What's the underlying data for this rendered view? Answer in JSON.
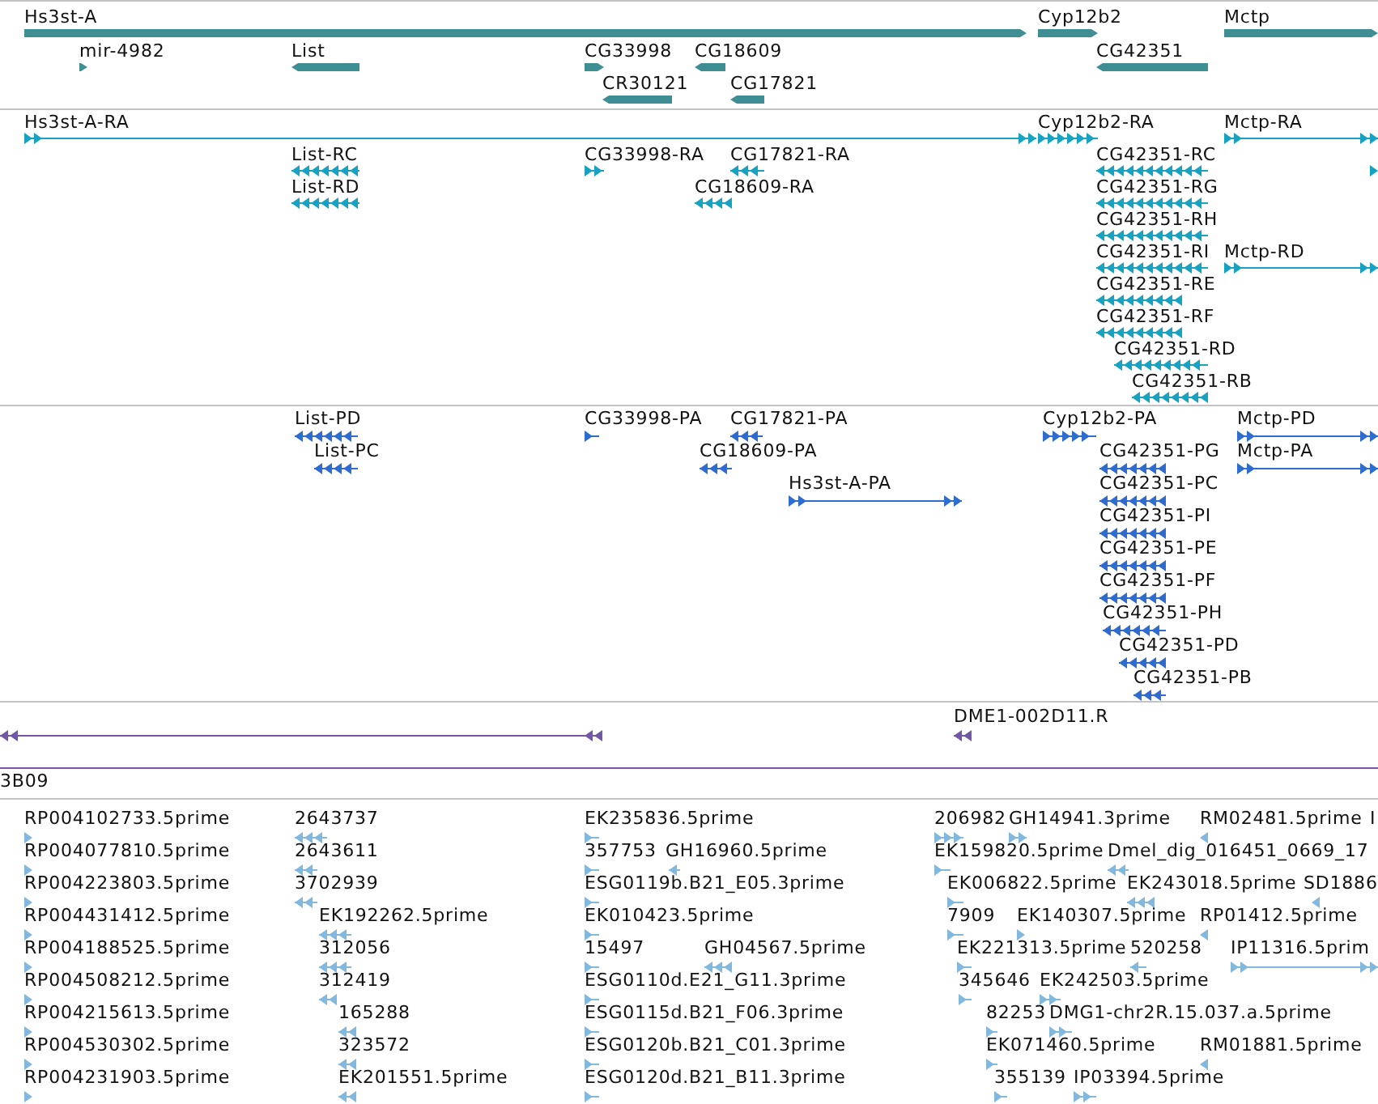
{
  "tracks": [
    {
      "kind": "gene",
      "color": "#3f8e93",
      "features": [
        {
          "label": "Hs3st-A",
          "reverse": false
        },
        {
          "label": "mir-4982",
          "reverse": false
        },
        {
          "label": "List",
          "reverse": true
        },
        {
          "label": "CG33998",
          "reverse": false
        },
        {
          "label": "CR30121",
          "reverse": true
        },
        {
          "label": "CG18609",
          "reverse": true
        },
        {
          "label": "CG17821",
          "reverse": true
        },
        {
          "label": "Cyp12b2",
          "reverse": false
        },
        {
          "label": "CG42351",
          "reverse": true
        },
        {
          "label": "Mctp",
          "reverse": false
        }
      ]
    },
    {
      "kind": "transcript",
      "color": "#17a2c2",
      "features": [
        {
          "label": "Hs3st-A-RA",
          "reverse": false
        },
        {
          "label": "Cyp12b2-RA",
          "reverse": false
        },
        {
          "label": "Mctp-RA",
          "reverse": false
        },
        {
          "label": "List-RC",
          "reverse": true
        },
        {
          "label": "CG33998-RA",
          "reverse": false
        },
        {
          "label": "CG17821-RA",
          "reverse": true
        },
        {
          "label": "CG42351-RC",
          "reverse": true
        },
        {
          "reverse": false
        },
        {
          "label": "List-RD",
          "reverse": true
        },
        {
          "label": "CG18609-RA",
          "reverse": true
        },
        {
          "label": "CG42351-RG",
          "reverse": true
        },
        {
          "label": "CG42351-RH",
          "reverse": true
        },
        {
          "label": "CG42351-RI",
          "reverse": true
        },
        {
          "label": "Mctp-RD",
          "reverse": false
        },
        {
          "label": "CG42351-RE",
          "reverse": true
        },
        {
          "label": "CG42351-RF",
          "reverse": true
        },
        {
          "label": "CG42351-RD",
          "reverse": true
        },
        {
          "label": "CG42351-RB",
          "reverse": true
        }
      ]
    },
    {
      "kind": "protein",
      "color": "#2f6ccf",
      "features": [
        {
          "label": "List-PD",
          "reverse": true
        },
        {
          "label": "CG33998-PA",
          "reverse": false
        },
        {
          "label": "CG17821-PA",
          "reverse": true
        },
        {
          "label": "Cyp12b2-PA",
          "reverse": false
        },
        {
          "label": "Mctp-PD",
          "reverse": false
        },
        {
          "label": "List-PC",
          "reverse": true
        },
        {
          "label": "CG18609-PA",
          "reverse": true
        },
        {
          "label": "CG42351-PG",
          "reverse": true
        },
        {
          "label": "Mctp-PA",
          "reverse": false
        },
        {
          "label": "Hs3st-A-PA",
          "reverse": false
        },
        {
          "label": "CG42351-PC",
          "reverse": true
        },
        {
          "label": "CG42351-PI",
          "reverse": true
        },
        {
          "label": "CG42351-PE",
          "reverse": true
        },
        {
          "label": "CG42351-PF",
          "reverse": true
        },
        {
          "label": "CG42351-PH",
          "reverse": true
        },
        {
          "label": "CG42351-PD",
          "reverse": true
        },
        {
          "label": "CG42351-PB",
          "reverse": true
        }
      ]
    },
    {
      "kind": "clone",
      "color": "#7157a6",
      "features": [
        {
          "reverse": true
        },
        {
          "label": "DME1-002D11.R",
          "reverse": true
        },
        {
          "kind": "span"
        },
        {
          "label": "3B09"
        }
      ]
    },
    {
      "kind": "est",
      "color": "#82b7de",
      "features": [
        {
          "label": "RP004102733.5prime",
          "reverse": false
        },
        {
          "label": "RP004077810.5prime",
          "reverse": false
        },
        {
          "label": "RP004223803.5prime",
          "reverse": false
        },
        {
          "label": "RP004431412.5prime",
          "reverse": false
        },
        {
          "label": "RP004188525.5prime",
          "reverse": false
        },
        {
          "label": "RP004508212.5prime",
          "reverse": false
        },
        {
          "label": "RP004215613.5prime",
          "reverse": false
        },
        {
          "label": "RP004530302.5prime",
          "reverse": false
        },
        {
          "label": "RP004231903.5prime",
          "reverse": false
        },
        {
          "label": "2643737",
          "reverse": true
        },
        {
          "label": "2643611",
          "reverse": true
        },
        {
          "label": "3702939",
          "reverse": true
        },
        {
          "label": "EK192262.5prime",
          "reverse": true
        },
        {
          "label": "312056",
          "reverse": true
        },
        {
          "label": "312419",
          "reverse": true
        },
        {
          "label": "165288",
          "reverse": true
        },
        {
          "label": "323572",
          "reverse": true
        },
        {
          "label": "EK201551.5prime",
          "reverse": true
        },
        {
          "label": "EK235836.5prime",
          "reverse": false
        },
        {
          "label": "357753",
          "reverse": false
        },
        {
          "label": "GH16960.5prime",
          "reverse": true
        },
        {
          "label": "ESG0119b.B21_E05.3prime",
          "reverse": false
        },
        {
          "label": "EK010423.5prime",
          "reverse": false
        },
        {
          "label": "15497",
          "reverse": false
        },
        {
          "label": "GH04567.5prime",
          "reverse": true
        },
        {
          "label": "ESG0110d.E21_G11.3prime",
          "reverse": false
        },
        {
          "label": "ESG0115d.B21_F06.3prime",
          "reverse": false
        },
        {
          "label": "ESG0120b.B21_C01.3prime",
          "reverse": false
        },
        {
          "label": "ESG0120d.B21_B11.3prime",
          "reverse": false
        },
        {
          "label": "206982",
          "reverse": false
        },
        {
          "label": "GH14941.3prime",
          "reverse": false
        },
        {
          "label": "RM02481.5prime",
          "reverse": true
        },
        {
          "label": "I"
        },
        {
          "label": "EK159820.5prime",
          "reverse": false
        },
        {
          "label": "Dmel_dig_016451_0669_17",
          "reverse": true
        },
        {
          "label": "EK006822.5prime",
          "reverse": false
        },
        {
          "label": "EK243018.5prime",
          "reverse": true
        },
        {
          "label": "SD1886",
          "reverse": true
        },
        {
          "label": "7909",
          "reverse": false
        },
        {
          "label": "EK140307.5prime",
          "reverse": false
        },
        {
          "label": "RP01412.5prime",
          "reverse": true
        },
        {
          "label": "EK221313.5prime",
          "reverse": false
        },
        {
          "label": "520258",
          "reverse": true
        },
        {
          "label": "IP11316.5prim",
          "reverse": false
        },
        {
          "label": "345646",
          "reverse": false
        },
        {
          "label": "EK242503.5prime",
          "reverse": false
        },
        {
          "label": "82253",
          "reverse": false
        },
        {
          "label": "DMG1-chr2R.15.037.a.5prime",
          "reverse": false
        },
        {
          "label": "EK071460.5prime",
          "reverse": false
        },
        {
          "label": "RM01881.5prime",
          "reverse": true
        },
        {
          "label": "355139",
          "reverse": false
        },
        {
          "label": "IP03394.5prime",
          "reverse": false
        }
      ]
    }
  ]
}
